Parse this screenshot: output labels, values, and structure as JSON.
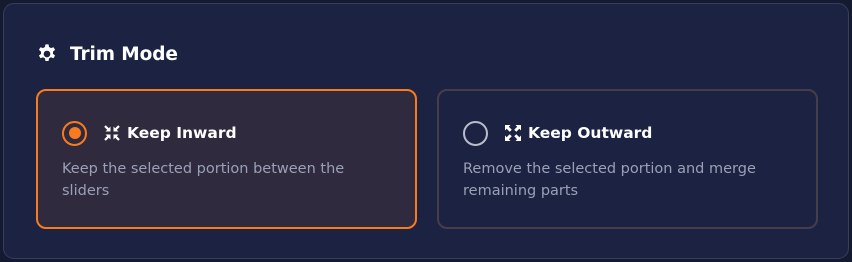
{
  "section": {
    "title": "Trim Mode",
    "icon": "gear-icon"
  },
  "colors": {
    "accent": "#f97b1e",
    "panel_bg": "#1c2342",
    "page_bg": "#141a30",
    "selected_bg": "#2f2a3e",
    "text_primary": "#ffffff",
    "text_secondary": "#9ba0b6"
  },
  "options": [
    {
      "label": "Keep Inward",
      "description": "Keep the selected portion between the sliders",
      "icon": "compress-arrows-icon",
      "selected": true
    },
    {
      "label": "Keep Outward",
      "description": "Remove the selected portion and merge remaining parts",
      "icon": "expand-arrows-icon",
      "selected": false
    }
  ]
}
